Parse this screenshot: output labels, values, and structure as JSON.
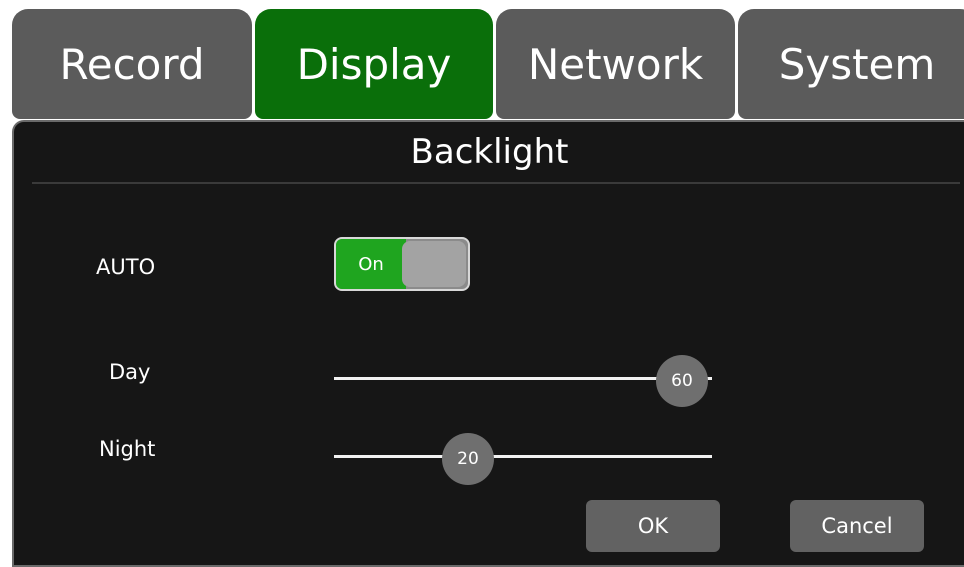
{
  "tabs": [
    {
      "label": "Record",
      "active": false
    },
    {
      "label": "Display",
      "active": true
    },
    {
      "label": "Network",
      "active": false
    },
    {
      "label": "System",
      "active": false
    }
  ],
  "panel": {
    "title": "Backlight"
  },
  "settings": {
    "auto": {
      "label": "AUTO",
      "toggle_text": "On",
      "enabled": true
    },
    "day": {
      "label": "Day",
      "value": "60"
    },
    "night": {
      "label": "Night",
      "value": "20"
    }
  },
  "buttons": {
    "ok": "OK",
    "cancel": "Cancel"
  },
  "colors": {
    "tab_bg": "#5b5b5b",
    "tab_active": "#0a6f0a",
    "panel_bg": "#161616",
    "toggle_on": "#1fa51f",
    "button_bg": "#626262"
  }
}
